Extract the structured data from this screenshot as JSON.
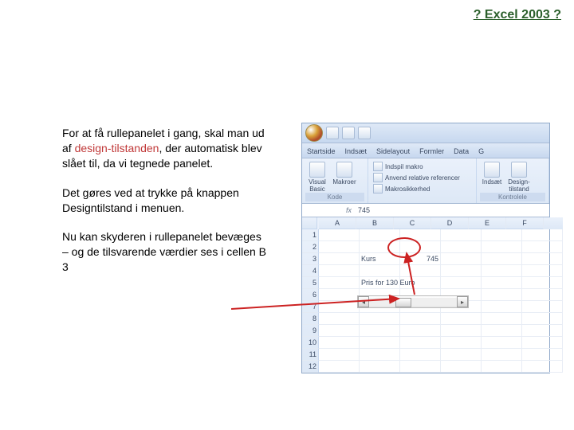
{
  "header": {
    "link": "? Excel 2003 ?"
  },
  "text": {
    "p1a": "For at få rullepanelet i gang, skal man ud af ",
    "p1b": "design-tilstanden",
    "p1c": ", der automatisk blev slået til, da vi tegnede panelet.",
    "p2": "Det gøres ved at trykke på knappen Designtilstand i menuen.",
    "p3": "Nu kan skyderen i rullepanelet bevæges – og de tilsvarende værdier ses i cellen B 3"
  },
  "excel": {
    "tabs": [
      "Startside",
      "Indsæt",
      "Sidelayout",
      "Formler",
      "Data",
      "G"
    ],
    "ribbon": {
      "group1": {
        "btn1": "Visual Basic",
        "btn2": "Makroer",
        "title": "Kode"
      },
      "mid": {
        "item1": "Indspil makro",
        "item2": "Anvend relative referencer",
        "item3": "Makrosikkerhed"
      },
      "group3": {
        "btn1": "Indsæt",
        "btn2": "Design-tilstand",
        "title": "Kontrolele"
      }
    },
    "formula": {
      "name": "",
      "fx": "fx",
      "value": "745"
    },
    "cols": [
      "A",
      "B",
      "C",
      "D",
      "E",
      "F"
    ],
    "rows": [
      "1",
      "2",
      "3",
      "4",
      "5",
      "6",
      "7",
      "8",
      "9",
      "10",
      "11",
      "12"
    ],
    "celltexts": {
      "B3": "Kurs",
      "C3": "745",
      "B5": "Pris for 130 Euro"
    }
  }
}
